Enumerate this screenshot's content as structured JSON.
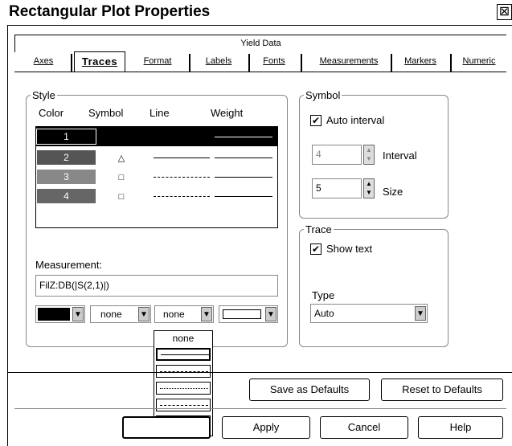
{
  "window": {
    "title": "Rectangular Plot Properties",
    "close_glyph": "⊠"
  },
  "tabs": {
    "top_tab": "Yield Data",
    "items": [
      "Axes",
      "Traces",
      "Format",
      "Labels",
      "Fonts",
      "Measurements",
      "Markers",
      "Numeric"
    ],
    "active": "Traces"
  },
  "style_group": {
    "legend": "Style",
    "headers": {
      "color": "Color",
      "symbol": "Symbol",
      "line": "Line",
      "weight": "Weight"
    },
    "traces": [
      {
        "num": "1",
        "symbol": "",
        "line": "solid",
        "selected": true
      },
      {
        "num": "2",
        "symbol": "△",
        "line": "solid"
      },
      {
        "num": "3",
        "symbol": "□",
        "line": "dashed"
      },
      {
        "num": "4",
        "symbol": "□",
        "line": "dashed"
      }
    ],
    "measurement_label": "Measurement:",
    "measurement_value": "FilZ:DB(|S(2,1)|)",
    "color_combo": "",
    "symbol_combo": "none",
    "line_combo": "none",
    "dropdown_options": [
      "none",
      "solid",
      "dashed",
      "dotted",
      "dash-dot",
      "dash-dot-dot"
    ]
  },
  "symbol_group": {
    "legend": "Symbol",
    "auto_interval_label": "Auto interval",
    "auto_interval_checked": true,
    "interval_value": "4",
    "interval_label": "Interval",
    "size_value": "5",
    "size_label": "Size"
  },
  "trace_group": {
    "legend": "Trace",
    "show_text_label": "Show text",
    "show_text_checked": true,
    "type_label": "Type",
    "type_value": "Auto"
  },
  "buttons": {
    "save_defaults": "Save as Defaults",
    "reset_defaults": "Reset to Defaults",
    "ok": "",
    "apply": "Apply",
    "cancel": "Cancel",
    "help": "Help"
  }
}
